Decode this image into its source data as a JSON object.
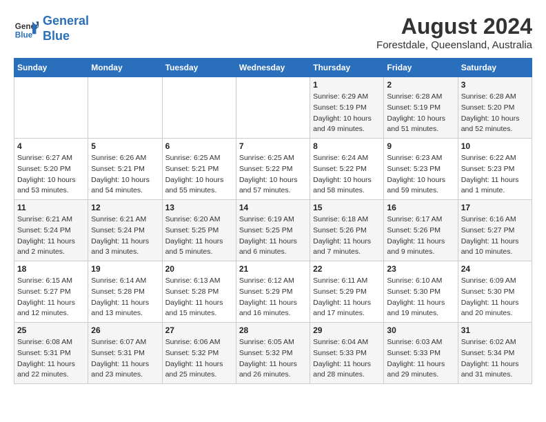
{
  "logo": {
    "text_general": "General",
    "text_blue": "Blue"
  },
  "title": "August 2024",
  "subtitle": "Forestdale, Queensland, Australia",
  "days_of_week": [
    "Sunday",
    "Monday",
    "Tuesday",
    "Wednesday",
    "Thursday",
    "Friday",
    "Saturday"
  ],
  "weeks": [
    [
      {
        "day": "",
        "info": ""
      },
      {
        "day": "",
        "info": ""
      },
      {
        "day": "",
        "info": ""
      },
      {
        "day": "",
        "info": ""
      },
      {
        "day": "1",
        "info": "Sunrise: 6:29 AM\nSunset: 5:19 PM\nDaylight: 10 hours\nand 49 minutes."
      },
      {
        "day": "2",
        "info": "Sunrise: 6:28 AM\nSunset: 5:19 PM\nDaylight: 10 hours\nand 51 minutes."
      },
      {
        "day": "3",
        "info": "Sunrise: 6:28 AM\nSunset: 5:20 PM\nDaylight: 10 hours\nand 52 minutes."
      }
    ],
    [
      {
        "day": "4",
        "info": "Sunrise: 6:27 AM\nSunset: 5:20 PM\nDaylight: 10 hours\nand 53 minutes."
      },
      {
        "day": "5",
        "info": "Sunrise: 6:26 AM\nSunset: 5:21 PM\nDaylight: 10 hours\nand 54 minutes."
      },
      {
        "day": "6",
        "info": "Sunrise: 6:25 AM\nSunset: 5:21 PM\nDaylight: 10 hours\nand 55 minutes."
      },
      {
        "day": "7",
        "info": "Sunrise: 6:25 AM\nSunset: 5:22 PM\nDaylight: 10 hours\nand 57 minutes."
      },
      {
        "day": "8",
        "info": "Sunrise: 6:24 AM\nSunset: 5:22 PM\nDaylight: 10 hours\nand 58 minutes."
      },
      {
        "day": "9",
        "info": "Sunrise: 6:23 AM\nSunset: 5:23 PM\nDaylight: 10 hours\nand 59 minutes."
      },
      {
        "day": "10",
        "info": "Sunrise: 6:22 AM\nSunset: 5:23 PM\nDaylight: 11 hours\nand 1 minute."
      }
    ],
    [
      {
        "day": "11",
        "info": "Sunrise: 6:21 AM\nSunset: 5:24 PM\nDaylight: 11 hours\nand 2 minutes."
      },
      {
        "day": "12",
        "info": "Sunrise: 6:21 AM\nSunset: 5:24 PM\nDaylight: 11 hours\nand 3 minutes."
      },
      {
        "day": "13",
        "info": "Sunrise: 6:20 AM\nSunset: 5:25 PM\nDaylight: 11 hours\nand 5 minutes."
      },
      {
        "day": "14",
        "info": "Sunrise: 6:19 AM\nSunset: 5:25 PM\nDaylight: 11 hours\nand 6 minutes."
      },
      {
        "day": "15",
        "info": "Sunrise: 6:18 AM\nSunset: 5:26 PM\nDaylight: 11 hours\nand 7 minutes."
      },
      {
        "day": "16",
        "info": "Sunrise: 6:17 AM\nSunset: 5:26 PM\nDaylight: 11 hours\nand 9 minutes."
      },
      {
        "day": "17",
        "info": "Sunrise: 6:16 AM\nSunset: 5:27 PM\nDaylight: 11 hours\nand 10 minutes."
      }
    ],
    [
      {
        "day": "18",
        "info": "Sunrise: 6:15 AM\nSunset: 5:27 PM\nDaylight: 11 hours\nand 12 minutes."
      },
      {
        "day": "19",
        "info": "Sunrise: 6:14 AM\nSunset: 5:28 PM\nDaylight: 11 hours\nand 13 minutes."
      },
      {
        "day": "20",
        "info": "Sunrise: 6:13 AM\nSunset: 5:28 PM\nDaylight: 11 hours\nand 15 minutes."
      },
      {
        "day": "21",
        "info": "Sunrise: 6:12 AM\nSunset: 5:29 PM\nDaylight: 11 hours\nand 16 minutes."
      },
      {
        "day": "22",
        "info": "Sunrise: 6:11 AM\nSunset: 5:29 PM\nDaylight: 11 hours\nand 17 minutes."
      },
      {
        "day": "23",
        "info": "Sunrise: 6:10 AM\nSunset: 5:30 PM\nDaylight: 11 hours\nand 19 minutes."
      },
      {
        "day": "24",
        "info": "Sunrise: 6:09 AM\nSunset: 5:30 PM\nDaylight: 11 hours\nand 20 minutes."
      }
    ],
    [
      {
        "day": "25",
        "info": "Sunrise: 6:08 AM\nSunset: 5:31 PM\nDaylight: 11 hours\nand 22 minutes."
      },
      {
        "day": "26",
        "info": "Sunrise: 6:07 AM\nSunset: 5:31 PM\nDaylight: 11 hours\nand 23 minutes."
      },
      {
        "day": "27",
        "info": "Sunrise: 6:06 AM\nSunset: 5:32 PM\nDaylight: 11 hours\nand 25 minutes."
      },
      {
        "day": "28",
        "info": "Sunrise: 6:05 AM\nSunset: 5:32 PM\nDaylight: 11 hours\nand 26 minutes."
      },
      {
        "day": "29",
        "info": "Sunrise: 6:04 AM\nSunset: 5:33 PM\nDaylight: 11 hours\nand 28 minutes."
      },
      {
        "day": "30",
        "info": "Sunrise: 6:03 AM\nSunset: 5:33 PM\nDaylight: 11 hours\nand 29 minutes."
      },
      {
        "day": "31",
        "info": "Sunrise: 6:02 AM\nSunset: 5:34 PM\nDaylight: 11 hours\nand 31 minutes."
      }
    ]
  ]
}
